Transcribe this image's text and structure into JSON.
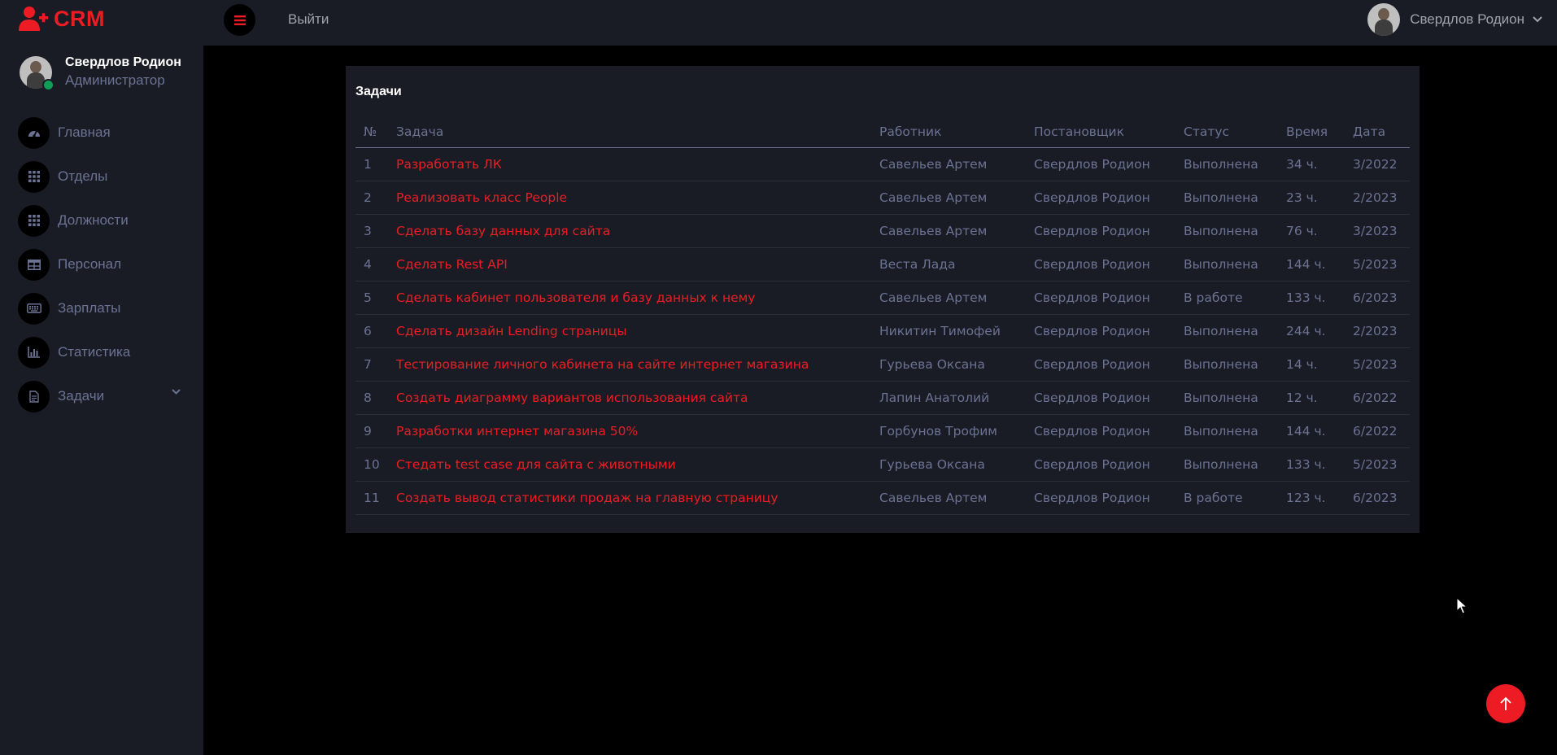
{
  "brand": {
    "name": "CRM",
    "color": "#ed1c24"
  },
  "header": {
    "logout_label": "Выйти",
    "user_name": "Свердлов Родион",
    "icons": {
      "menu": "hamburger-icon",
      "dropdown": "chevron-down-icon"
    }
  },
  "sidebar": {
    "user": {
      "name": "Свердлов Родион",
      "role": "Администратор",
      "status": "online"
    },
    "items": [
      {
        "label": "Главная",
        "icon": "dashboard-icon"
      },
      {
        "label": "Отделы",
        "icon": "grid-icon"
      },
      {
        "label": "Должности",
        "icon": "grid-icon"
      },
      {
        "label": "Персонал",
        "icon": "table-icon"
      },
      {
        "label": "Зарплаты",
        "icon": "keyboard-icon"
      },
      {
        "label": "Статистика",
        "icon": "chart-icon"
      },
      {
        "label": "Задачи",
        "icon": "document-icon",
        "has_submenu": true
      }
    ]
  },
  "tasks": {
    "title": "Задачи",
    "columns": [
      "№",
      "Задача",
      "Работник",
      "Постановщик",
      "Статус",
      "Время",
      "Дата"
    ],
    "rows": [
      [
        "1",
        "Разработать ЛК",
        "Савельев Артем",
        "Свердлов Родион",
        "Выполнена",
        "34 ч.",
        "3/2022"
      ],
      [
        "2",
        "Реализовать класс People",
        "Савельев Артем",
        "Свердлов Родион",
        "Выполнена",
        "23 ч.",
        "2/2023"
      ],
      [
        "3",
        "Сделать базу данных для сайта",
        "Савельев Артем",
        "Свердлов Родион",
        "Выполнена",
        "76 ч.",
        "3/2023"
      ],
      [
        "4",
        "Сделать Rest API",
        "Веста Лада",
        "Свердлов Родион",
        "Выполнена",
        "144 ч.",
        "5/2023"
      ],
      [
        "5",
        "Сделать кабинет пользователя и базу данных к нему",
        "Савельев Артем",
        "Свердлов Родион",
        "В работе",
        "133 ч.",
        "6/2023"
      ],
      [
        "6",
        "Сделать дизайн Lending страницы",
        "Никитин Тимофей",
        "Свердлов Родион",
        "Выполнена",
        "244 ч.",
        "2/2023"
      ],
      [
        "7",
        "Тестирование личного кабинета на сайте интернет магазина",
        "Гурьева Оксана",
        "Свердлов Родион",
        "Выполнена",
        "14 ч.",
        "5/2023"
      ],
      [
        "8",
        "Создать диаграмму вариантов использования сайта",
        "Лапин Анатолий",
        "Свердлов Родион",
        "Выполнена",
        "12 ч.",
        "6/2022"
      ],
      [
        "9",
        "Разработки интернет магазина 50%",
        "Горбунов Трофим",
        "Свердлов Родион",
        "Выполнена",
        "144 ч.",
        "6/2022"
      ],
      [
        "10",
        "Стедать test case для сайта с животными",
        "Гурьева Оксана",
        "Свердлов Родион",
        "Выполнена",
        "133 ч.",
        "5/2023"
      ],
      [
        "11",
        "Создать вывод статистики продаж на главную страницу",
        "Савельев Артем",
        "Свердлов Родион",
        "В работе",
        "123 ч.",
        "6/2023"
      ]
    ]
  },
  "scroll_top": {
    "icon": "arrow-up-icon"
  }
}
